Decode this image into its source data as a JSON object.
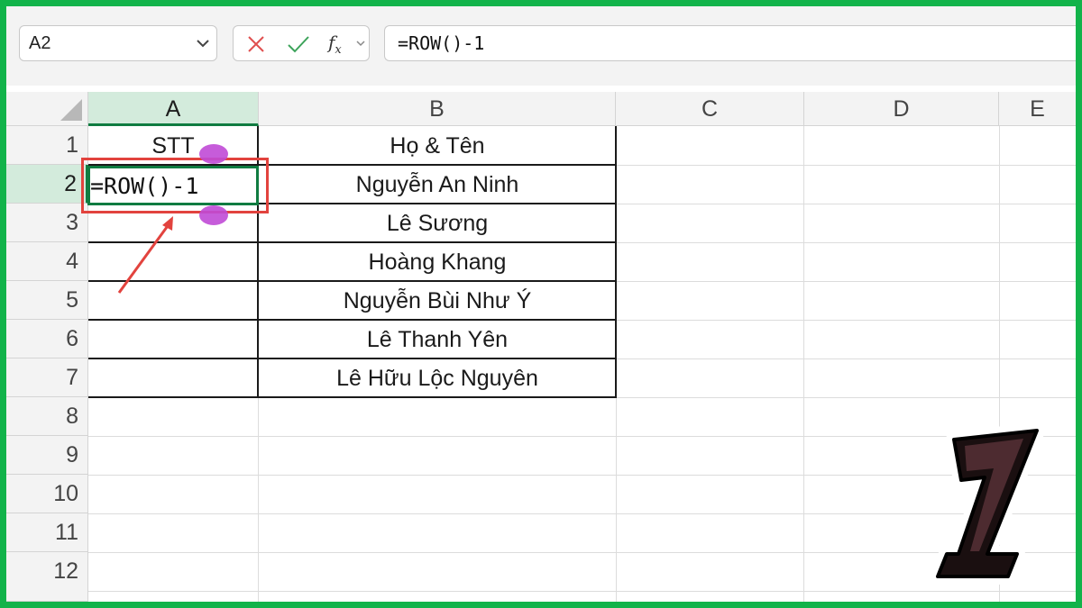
{
  "name_box": {
    "value": "A2"
  },
  "formula_bar": {
    "cancel_icon": "x-icon",
    "enter_icon": "check-icon",
    "fx_label": "f",
    "fx_sub": "x",
    "value": "=ROW()-1"
  },
  "columns": [
    "A",
    "B",
    "C",
    "D",
    "E"
  ],
  "rows": [
    "1",
    "2",
    "3",
    "4",
    "5",
    "6",
    "7",
    "8",
    "9",
    "10",
    "11",
    "12"
  ],
  "cells": {
    "A1": "STT",
    "A2": "=ROW()-1",
    "B1": "Họ & Tên",
    "B2": "Nguyễn An Ninh",
    "B3": "Lê Sương",
    "B4": "Hoàng Khang",
    "B5": "Nguyễn Bùi Như Ý",
    "B6": "Lê Thanh Yên",
    "B7": "Lê Hữu Lộc Nguyên"
  },
  "badge": {
    "number": "1"
  },
  "colors": {
    "frame": "#12b34a",
    "selection": "#107c41",
    "highlight": "#e2433e",
    "handle": "#c04ad6"
  }
}
